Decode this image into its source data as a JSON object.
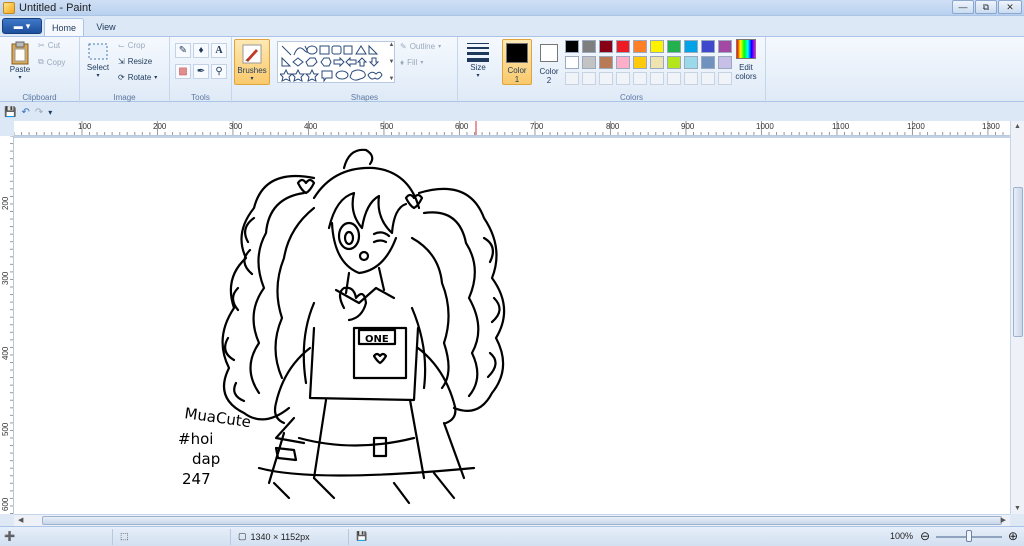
{
  "window": {
    "title": "Untitled - Paint"
  },
  "tabs": {
    "home": "Home",
    "view": "View"
  },
  "clipboard": {
    "paste": "Paste",
    "cut": "Cut",
    "copy": "Copy",
    "label": "Clipboard"
  },
  "image": {
    "select": "Select",
    "crop": "Crop",
    "resize": "Resize",
    "rotate": "Rotate",
    "label": "Image"
  },
  "tools": {
    "label": "Tools"
  },
  "brushes": {
    "label": "Brushes"
  },
  "shapes": {
    "outline": "Outline",
    "fill": "Fill",
    "label": "Shapes"
  },
  "size": {
    "label": "Size"
  },
  "colors": {
    "color1_label": "Color",
    "color1_num": "1",
    "color2_label": "Color",
    "color2_num": "2",
    "color1_value": "#000000",
    "color2_value": "#ffffff",
    "edit_line1": "Edit",
    "edit_line2": "colors",
    "label": "Colors",
    "palette_row1": [
      "#000000",
      "#7f7f7f",
      "#880015",
      "#ed1c24",
      "#ff7f27",
      "#fff200",
      "#22b14c",
      "#00a2e8",
      "#3f48cc",
      "#a349a4"
    ],
    "palette_row2": [
      "#ffffff",
      "#c3c3c3",
      "#b97a57",
      "#ffaec9",
      "#ffc90e",
      "#efe4b0",
      "#b5e61d",
      "#99d9ea",
      "#7092be",
      "#c8bfe7"
    ]
  },
  "ruler": {
    "h": [
      "100",
      "200",
      "300",
      "400",
      "500",
      "600",
      "700",
      "800",
      "900",
      "1000",
      "1100",
      "1200",
      "1300"
    ],
    "v": [
      "200",
      "300",
      "400",
      "500",
      "600"
    ]
  },
  "canvas": {
    "signature": [
      "MuaCute",
      "#hoi",
      "dap",
      "247"
    ],
    "shirt_text": "ONE"
  },
  "status": {
    "dimensions": "1340 × 1152px",
    "zoom": "100%"
  }
}
